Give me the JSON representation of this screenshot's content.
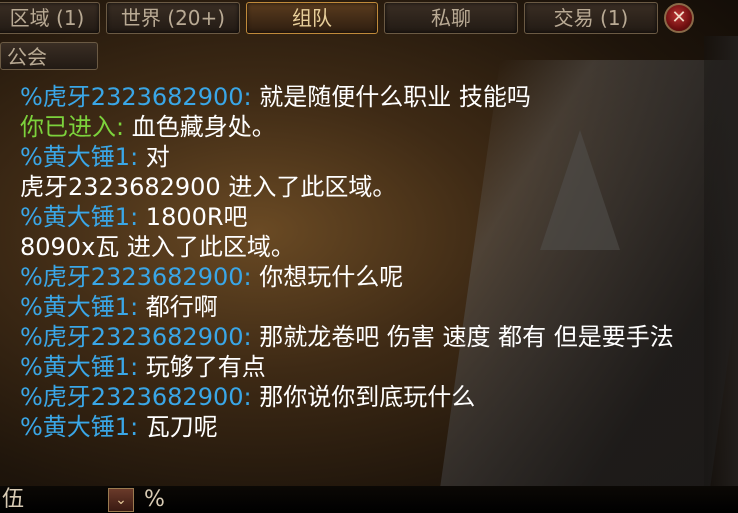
{
  "tabs": {
    "region": "区域 (1)",
    "world": "世界 (20+)",
    "team": "组队",
    "private": "私聊",
    "trade": "交易 (1)",
    "guild": "公会"
  },
  "close_icon_glyph": "✕",
  "chat": {
    "lines": [
      {
        "user": "%虎牙2323682900:",
        "text": " 就是随便什么职业 技能吗"
      },
      {
        "system": "你已进入:",
        "text": " 血色藏身处。"
      },
      {
        "user": "%黄大锤1:",
        "text": " 对"
      },
      {
        "text": "虎牙2323682900 进入了此区域。"
      },
      {
        "user": "%黄大锤1:",
        "text": " 1800R吧"
      },
      {
        "text": "8090x瓦 进入了此区域。"
      },
      {
        "user": "%虎牙2323682900:",
        "text": "  你想玩什么呢"
      },
      {
        "user": "%黄大锤1:",
        "text": " 都行啊"
      },
      {
        "user": "%虎牙2323682900:",
        "text": " 那就龙卷吧 伤害 速度 都有 但是要手法"
      },
      {
        "user": "%黄大锤1:",
        "text": " 玩够了有点"
      },
      {
        "user": "%虎牙2323682900:",
        "text": " 那你说你到底玩什么"
      },
      {
        "user": "%黄大锤1:",
        "text": " 瓦刀呢"
      }
    ]
  },
  "bottom": {
    "label": "伍",
    "input_prefix": "%",
    "channel_icon_glyph": "⌄"
  },
  "colors": {
    "user_name": "#3aa6e6",
    "system": "#7cd23c",
    "message": "#ffffff",
    "active_tab": "#e8cf9a"
  }
}
